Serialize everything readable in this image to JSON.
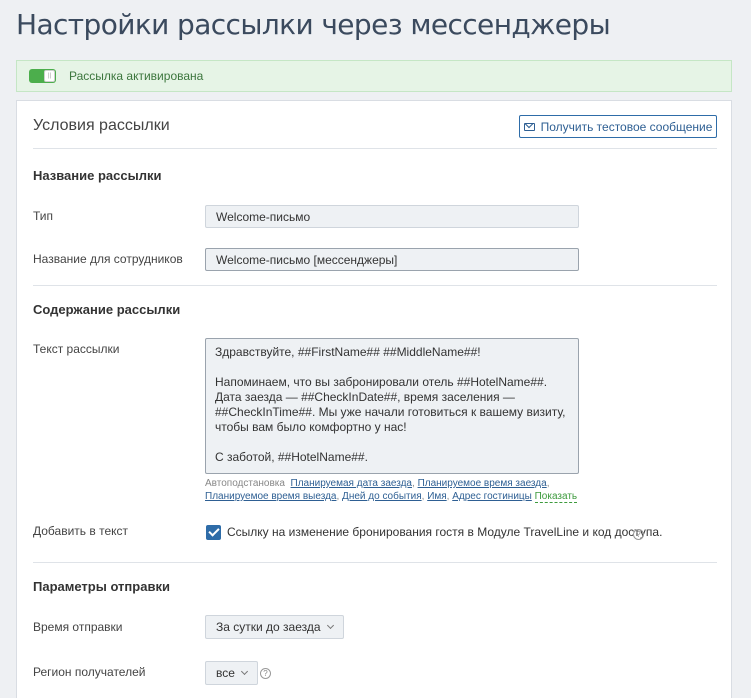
{
  "page": {
    "title": "Настройки рассылки через мессенджеры"
  },
  "alert": {
    "text": "Рассылка активирована"
  },
  "panel": {
    "title": "Условия рассылки",
    "test_button": "Получить тестовое сообщение"
  },
  "name_section": {
    "title": "Название рассылки",
    "type_label": "Тип",
    "type_value": "Welcome-письмо",
    "staff_name_label": "Название для сотрудников",
    "staff_name_value": "Welcome-письмо [мессенджеры]"
  },
  "content_section": {
    "title": "Содержание рассылки",
    "text_label": "Текст рассылки",
    "text_value": "Здравствуйте, ##FirstName## ##MiddleName##!\n\nНапоминаем, что вы забронировали отель ##HotelName##. Дата заезда — ##CheckInDate##, время заселения — ##CheckInTime##. Мы уже начали готовиться к вашему визиту, чтобы вам было комфортно у нас!\n\nС заботой, ##HotelName##.",
    "autosub_label": "Автоподстановка",
    "autosub_links": [
      "Планируемая дата заезда",
      "Планируемое время заезда",
      "Планируемое время выезда",
      "Дней до события",
      "Имя",
      "Адрес гостиницы"
    ],
    "autosub_show": "Показать",
    "add_label": "Добавить в текст",
    "add_checkbox_label": "Ссылку на изменение бронирования гостя в Модуле TravelLine и код доступа.",
    "add_checked": true
  },
  "send_section": {
    "title": "Параметры отправки",
    "time_label": "Время отправки",
    "time_value": "За сутки до заезда",
    "region_label": "Регион получателей",
    "region_value": "все"
  },
  "icons": {
    "toggle": "toggle-on-icon",
    "envelope": "envelope-icon",
    "help": "question-circle-icon",
    "chevron": "chevron-down-icon",
    "check": "checkmark-icon"
  },
  "colors": {
    "accent": "#2e6ca8",
    "success": "#4cae4c",
    "success_bg": "#e6f4e6"
  }
}
